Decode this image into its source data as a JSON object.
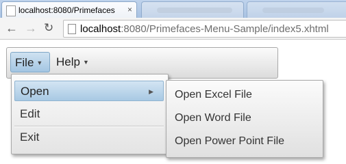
{
  "browser": {
    "tab_title": "localhost:8080/Primefaces",
    "tab_close": "×",
    "url_host": "localhost",
    "url_rest": ":8080/Primefaces-Menu-Sample/index5.xhtml",
    "back_icon": "←",
    "forward_icon": "→",
    "reload_icon": "↻"
  },
  "menubar": {
    "items": [
      {
        "label": "File",
        "caret": "▼"
      },
      {
        "label": "Help",
        "caret": "▼"
      }
    ]
  },
  "submenu": {
    "items": [
      {
        "label": "Open",
        "arrow": "▶"
      },
      {
        "label": "Edit"
      },
      {
        "label": "Exit"
      }
    ]
  },
  "nested_menu": {
    "items": [
      {
        "label": "Open Excel File"
      },
      {
        "label": "Open Word File"
      },
      {
        "label": "Open Power Point File"
      }
    ]
  },
  "colors": {
    "highlight_top": "#d3e5f3",
    "highlight_bottom": "#a8c9e3",
    "tabstrip": "#bfd3ec"
  },
  "icons": [
    "back-icon",
    "forward-icon",
    "reload-icon",
    "page-icon",
    "favicon-icon",
    "close-icon",
    "caret-down-icon",
    "caret-right-icon"
  ]
}
